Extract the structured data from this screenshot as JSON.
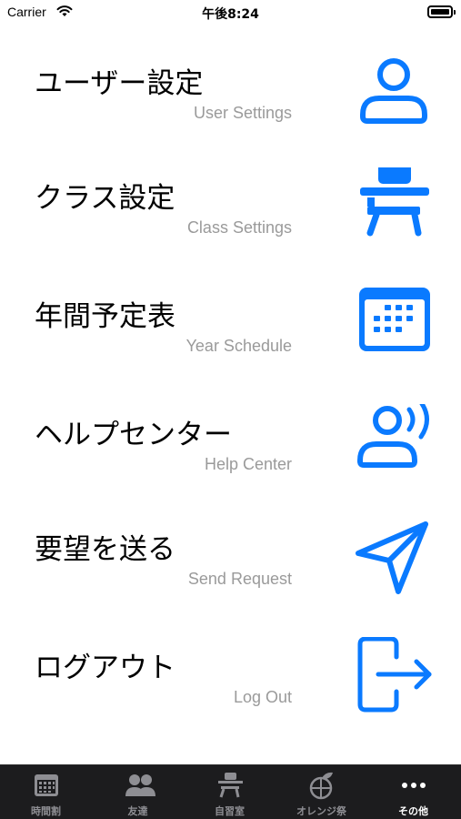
{
  "status": {
    "carrier": "Carrier",
    "time": "午後8:24"
  },
  "accent_color": "#0a7aff",
  "menu": [
    {
      "title": "ユーザー設定",
      "subtitle": "User Settings",
      "icon": "person-icon"
    },
    {
      "title": "クラス設定",
      "subtitle": "Class Settings",
      "icon": "desk-icon"
    },
    {
      "title": "年間予定表",
      "subtitle": "Year Schedule",
      "icon": "calendar-icon"
    },
    {
      "title": "ヘルプセンター",
      "subtitle": "Help Center",
      "icon": "person-speaking-icon"
    },
    {
      "title": "要望を送る",
      "subtitle": "Send Request",
      "icon": "paper-plane-icon"
    },
    {
      "title": "ログアウト",
      "subtitle": "Log Out",
      "icon": "logout-icon"
    }
  ],
  "tabs": [
    {
      "label": "時間割",
      "icon": "timetable-icon",
      "active": false
    },
    {
      "label": "友達",
      "icon": "friends-icon",
      "active": false
    },
    {
      "label": "自習室",
      "icon": "desk-icon",
      "active": false
    },
    {
      "label": "オレンジ祭",
      "icon": "orange-icon",
      "active": false
    },
    {
      "label": "その他",
      "icon": "more-icon",
      "active": true
    }
  ]
}
